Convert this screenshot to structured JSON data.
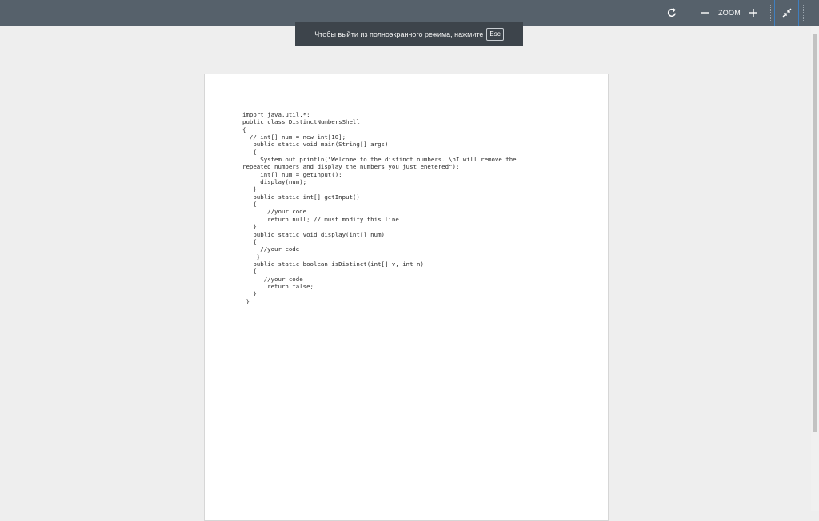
{
  "toolbar": {
    "rotate_icon": "rotate-icon",
    "zoom_out_icon": "minus-icon",
    "zoom_label": "ZOOM",
    "zoom_in_icon": "plus-icon",
    "exit_fullscreen_icon": "exit-fullscreen-icon"
  },
  "notice": {
    "text": "Чтобы выйти из полноэкранного режима, нажмите",
    "key": "Esc"
  },
  "document": {
    "code": "import java.util.*;\npublic class DistinctNumbersShell\n{\n  // int[] num = new int[10];\n   public static void main(String[] args)\n   {\n     System.out.println(\"Welcome to the distinct numbers. \\nI will remove the\nrepeated numbers and display the numbers you just enetered\");\n     int[] num = getInput();\n     display(num);\n   }\n   public static int[] getInput()\n   {\n       //your code\n       return null; // must modify this line\n   }\n   public static void display(int[] num)\n   {\n     //your code\n    }\n   public static boolean isDistinct(int[] v, int n)\n   {\n      //your code\n       return false;\n   }\n }"
  },
  "colors": {
    "toolbar_bg": "#56616b",
    "notice_bg": "#3d444b",
    "page_bg": "#ffffff",
    "viewer_bg": "#eeeeee",
    "accent": "#3f7fc0"
  }
}
